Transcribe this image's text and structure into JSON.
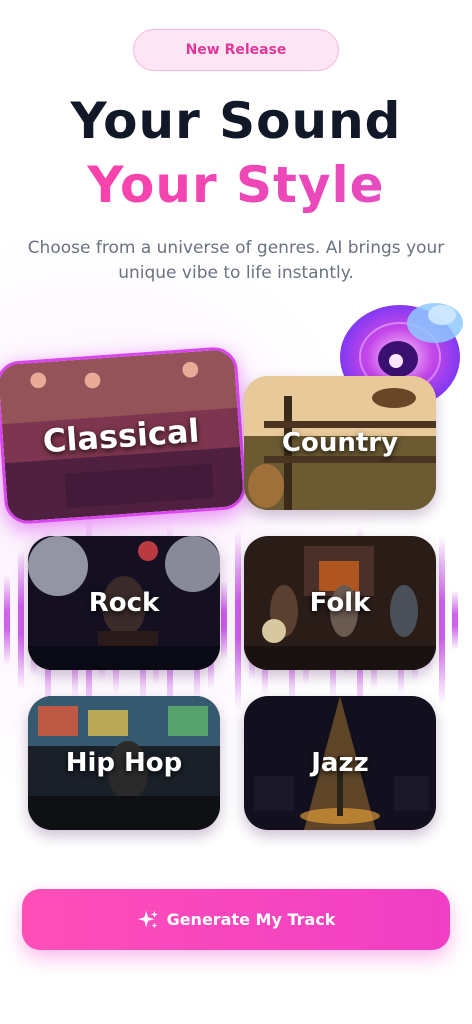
{
  "badge": "New Release",
  "hero": {
    "title_line1": "Your Sound",
    "title_line2": "Your Style",
    "subtitle": "Choose from a universe of genres. AI brings your unique vibe to life instantly."
  },
  "genres": [
    {
      "label": "Classical",
      "selected": true
    },
    {
      "label": "Country",
      "selected": false
    },
    {
      "label": "Rock",
      "selected": false
    },
    {
      "label": "Folk",
      "selected": false
    },
    {
      "label": "Hip Hop",
      "selected": false
    },
    {
      "label": "Jazz",
      "selected": false
    }
  ],
  "cta": {
    "label": "Generate My Track",
    "icon": "sparkles-icon"
  },
  "colors": {
    "accent": "#f03ec5",
    "title_dark": "#111827",
    "equalizer": "#c846eb"
  }
}
